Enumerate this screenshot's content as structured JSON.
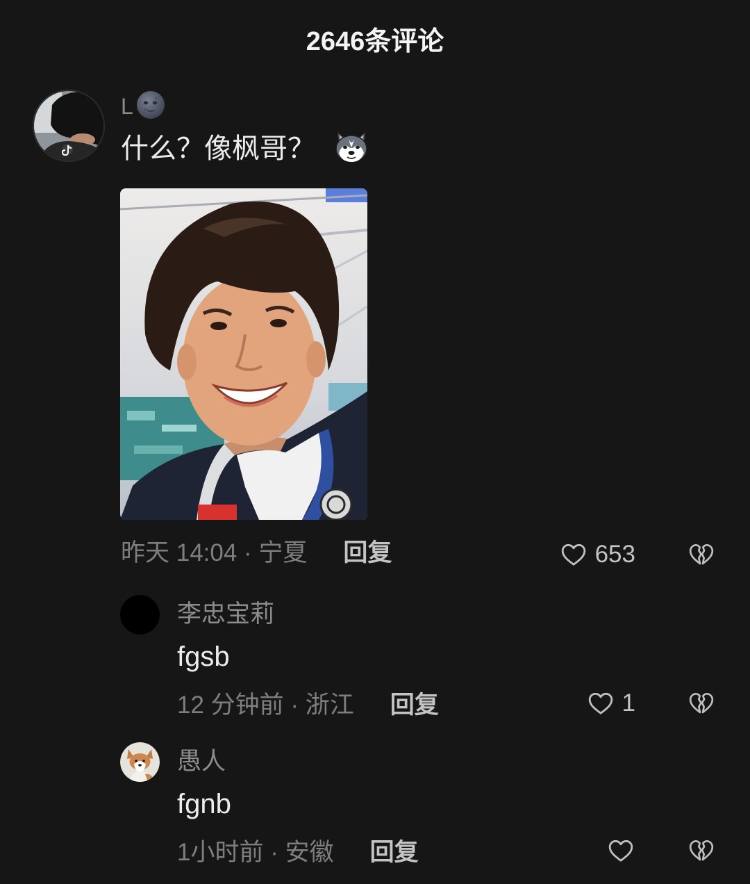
{
  "header": {
    "title": "2646条评论"
  },
  "colors": {
    "background": "#161616",
    "text_primary": "#ececec",
    "text_secondary": "#8c8c8c",
    "meta": "#7e7e7e",
    "action": "#c4c4c4"
  },
  "icons": {
    "like": "heart-outline-icon",
    "dislike": "broken-heart-icon",
    "username_emoji": "new-moon-face-emoji",
    "comment_emoji": "husky-emoji"
  },
  "comment": {
    "username": "L",
    "text": "什么？像枫哥？",
    "time_location": "昨天 14:04 · 宁夏",
    "reply_label": "回复",
    "likes": "653",
    "replies": [
      {
        "username": "李忠宝莉",
        "text": "fgsb",
        "time_location": "12 分钟前 · 浙江",
        "reply_label": "回复",
        "likes": "1"
      },
      {
        "username": "愚人",
        "text": "fgnb",
        "time_location": "1小时前 · 安徽",
        "reply_label": "回复"
      }
    ]
  }
}
